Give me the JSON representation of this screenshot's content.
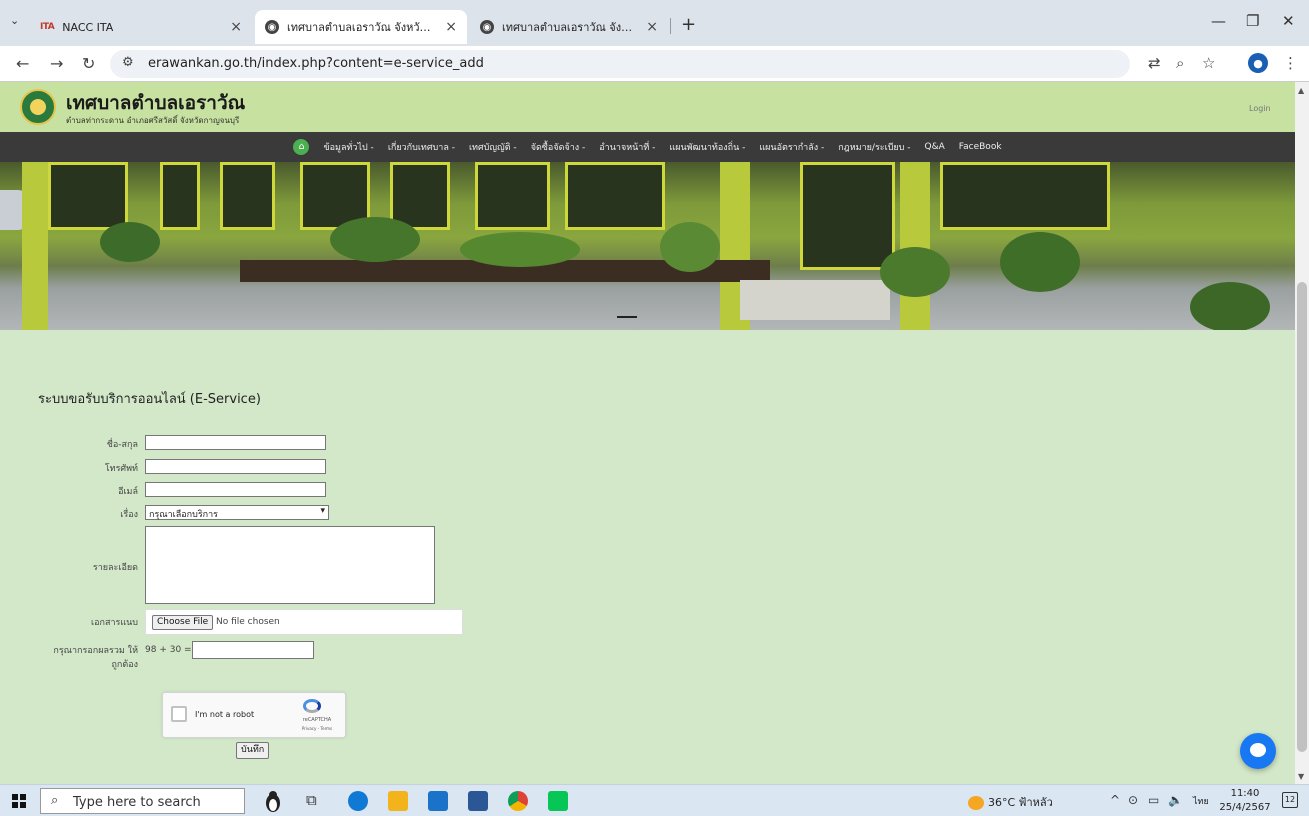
{
  "browser": {
    "tabs": [
      {
        "title": "NACC ITA",
        "favicon": "ITA"
      },
      {
        "title": "เทศบาลตำบลเอราวัณ จังหวัดกาญจน"
      },
      {
        "title": "เทศบาลตำบลเอราวัณ จังหวัดกาญจน"
      }
    ],
    "url": "erawankan.go.th/index.php?content=e-service_add"
  },
  "site": {
    "title": "เทศบาลตำบลเอราวัณ",
    "subtitle": "ตำบลท่ากระดาน อำเภอศรีสวัสดิ์ จังหวัดกาญจนบุรี",
    "login": "Login",
    "menu": [
      "ข้อมูลทั่วไป -",
      "เกี่ยวกับเทศบาล -",
      "เทศบัญญัติ -",
      "จัดซื้อจัดจ้าง -",
      "อำนาจหน้าที่ -",
      "แผนพัฒนาท้องถิ่น -",
      "แผนอัตรากำลัง -",
      "กฎหมาย/ระเบียบ -",
      "Q&A",
      "FaceBook"
    ]
  },
  "form": {
    "title": "ระบบขอรับบริการออนไลน์ (E-Service)",
    "name_label": "ชื่อ-สกุล",
    "phone_label": "โทรศัพท์",
    "email_label": "อีเมล์",
    "subject_label": "เรื่อง",
    "subject_value": "กรุณาเลือกบริการ",
    "detail_label": "รายละเอียด",
    "attach_label": "เอกสารแนบ",
    "choose_file": "Choose File",
    "no_file": "No file chosen",
    "captcha_label_1": "กรุณากรอกผลรวม ให้",
    "captcha_label_2": "ถูกต้อง",
    "captcha_equation": "98 + 30 =",
    "recaptcha_text": "I'm not a robot",
    "recaptcha_brand": "reCAPTCHA",
    "recaptcha_terms": "Privacy - Terms",
    "submit": "บันทึก"
  },
  "taskbar": {
    "search_placeholder": "Type here to search",
    "weather": "36°C ฟ้าหลัว",
    "lang": "ไทย",
    "time": "11:40",
    "date": "25/4/2567",
    "notifications": "12"
  },
  "colors": {
    "page_bg": "#d3e8c9",
    "header_bg": "#c6e1a0",
    "nav_bg": "#3a3a3a",
    "messenger": "#1877f2"
  }
}
